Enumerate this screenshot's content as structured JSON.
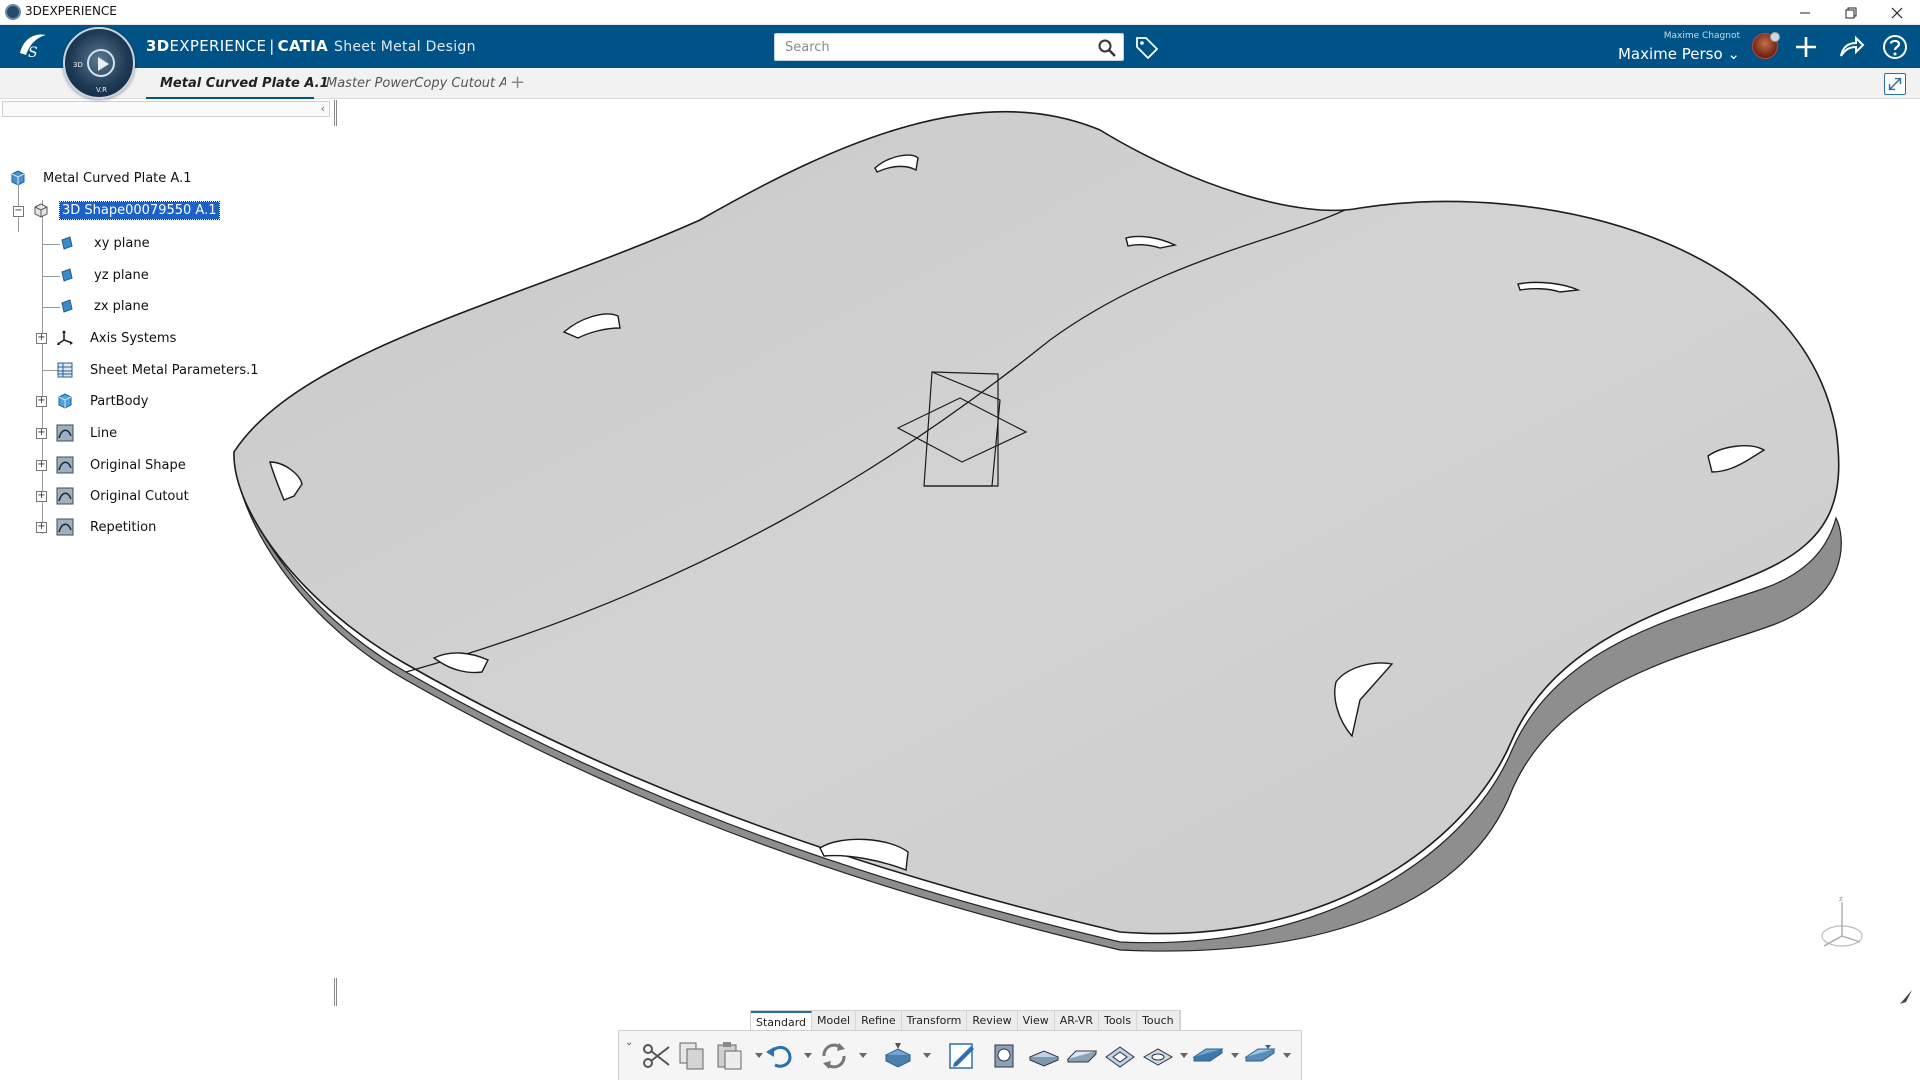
{
  "window": {
    "title": "3DEXPERIENCE",
    "controls": [
      "minimize-icon",
      "restore-icon",
      "close-icon"
    ]
  },
  "header": {
    "brand_prefix": "3D",
    "brand_rest": "EXPERIENCE",
    "brand_separator": "|",
    "brand_product": "CATIA",
    "app_name": "Sheet Metal Design",
    "compass_labels": [
      "3D",
      "V.R"
    ],
    "search_placeholder": "Search",
    "user_small": "Maxime Chagnot",
    "user_name": "Maxime Perso",
    "accent_color": "#005386"
  },
  "tabs": {
    "active": "Metal Curved Plate A.1",
    "second": "Master PowerCopy Cutout A",
    "add": "+"
  },
  "tree": {
    "collapse": "‹",
    "root": "Metal Curved Plate A.1",
    "selected": "3D Shape00079550 A.1",
    "items": [
      {
        "label": "xy plane",
        "icon": "plane-icon",
        "expandable": false
      },
      {
        "label": "yz plane",
        "icon": "plane-icon",
        "expandable": false
      },
      {
        "label": "zx plane",
        "icon": "plane-icon",
        "expandable": false
      },
      {
        "label": "Axis Systems",
        "icon": "axis-system-icon",
        "expandable": true
      },
      {
        "label": "Sheet Metal Parameters.1",
        "icon": "parameters-table-icon",
        "expandable": false
      },
      {
        "label": "PartBody",
        "icon": "part-body-icon",
        "expandable": true
      },
      {
        "label": "Line",
        "icon": "geometric-set-icon",
        "expandable": true
      },
      {
        "label": "Original Shape",
        "icon": "geometric-set-icon",
        "expandable": true
      },
      {
        "label": "Original Cutout",
        "icon": "geometric-set-icon",
        "expandable": true
      },
      {
        "label": "Repetition",
        "icon": "geometric-set-icon",
        "expandable": true
      }
    ],
    "expander_plus": "+",
    "expander_minus": "−"
  },
  "action_bar": {
    "tabs": [
      "Standard",
      "Model",
      "Refine",
      "Transform",
      "Review",
      "View",
      "AR-VR",
      "Tools",
      "Touch"
    ],
    "active_tab": "Standard",
    "tools": [
      "cut-icon",
      "copy-icon",
      "paste-icon",
      "undo-icon",
      "update-icon",
      "snap-icon",
      "sketch-icon",
      "wall-icon",
      "flange-icon",
      "hem-icon",
      "stamp-icon",
      "cutout-icon",
      "unfold-icon",
      "fold-icon"
    ]
  }
}
